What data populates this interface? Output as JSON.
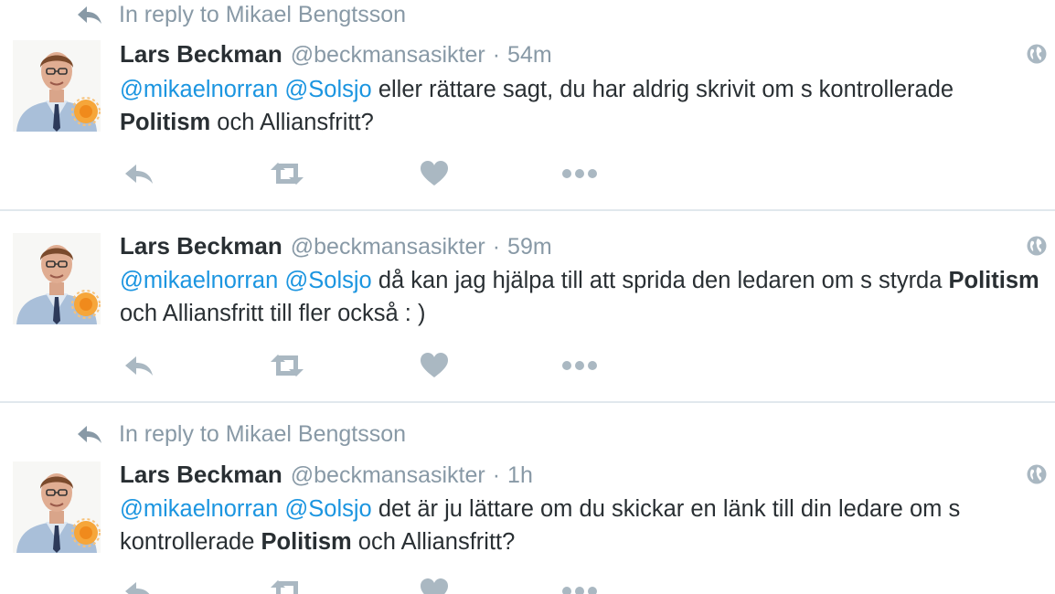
{
  "colors": {
    "mention": "#1b95e0",
    "muted": "#8899a6",
    "text": "#292f33",
    "divider": "#e1e8ed",
    "action_icon": "#aab8c2"
  },
  "tweets": [
    {
      "in_reply_to": "In reply to Mikael Bengtsson",
      "name": "Lars Beckman",
      "handle": "@beckmansasikter",
      "sep": "·",
      "time": "54m",
      "text": {
        "mention1": "@mikaelnorran",
        "mention2": "@Solsjo",
        "part1": " eller rättare sagt, du har aldrig skrivit om s kontrollerade ",
        "bold": "Politism",
        "part2": " och Alliansfritt?"
      },
      "icons": [
        "reply-icon",
        "retweet-icon",
        "like-icon",
        "more-icon",
        "globe-icon"
      ]
    },
    {
      "name": "Lars Beckman",
      "handle": "@beckmansasikter",
      "sep": "·",
      "time": "59m",
      "text": {
        "mention1": "@mikaelnorran",
        "mention2": "@Solsjo",
        "part1": " då kan jag hjälpa till att sprida den ledaren om s styrda ",
        "bold": "Politism",
        "part2": " och Alliansfritt till fler också : )"
      },
      "icons": [
        "reply-icon",
        "retweet-icon",
        "like-icon",
        "more-icon",
        "globe-icon"
      ]
    },
    {
      "in_reply_to": "In reply to Mikael Bengtsson",
      "name": "Lars Beckman",
      "handle": "@beckmansasikter",
      "sep": "·",
      "time": "1h",
      "text": {
        "mention1": "@mikaelnorran",
        "mention2": "@Solsjo",
        "part1": " det är ju lättare om du skickar en länk till din ledare om s kontrollerade ",
        "bold": "Politism",
        "part2": " och Alliansfritt?"
      },
      "icons": [
        "reply-icon",
        "retweet-icon",
        "like-icon",
        "more-icon",
        "globe-icon"
      ]
    }
  ]
}
